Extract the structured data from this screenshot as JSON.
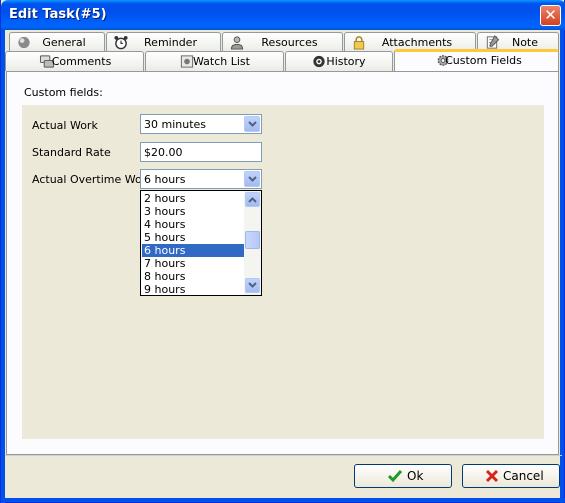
{
  "window": {
    "title": "Edit Task(#5)",
    "close_glyph": "✕"
  },
  "tabs_row1": [
    {
      "label": "General",
      "icon": "sphere-icon"
    },
    {
      "label": "Reminder",
      "icon": "alarm-clock-icon"
    },
    {
      "label": "Resources",
      "icon": "user-icon"
    },
    {
      "label": "Attachments",
      "icon": "lock-icon"
    },
    {
      "label": "Note",
      "icon": "note-icon"
    }
  ],
  "tabs_row2": [
    {
      "label": "Comments",
      "icon": "comments-icon"
    },
    {
      "label": "Watch List",
      "icon": "watch-list-icon"
    },
    {
      "label": "History",
      "icon": "history-icon"
    },
    {
      "label": "Custom Fields",
      "icon": "gear-icon",
      "active": true
    }
  ],
  "custom_fields": {
    "section_label": "Custom fields:",
    "actual_work": {
      "label": "Actual Work",
      "value": "30 minutes"
    },
    "standard_rate": {
      "label": "Standard Rate",
      "value": "$20.00"
    },
    "actual_overtime_work": {
      "label": "Actual Overtime Work",
      "value": "6 hours",
      "options": [
        "2 hours",
        "3 hours",
        "4 hours",
        "5 hours",
        "6 hours",
        "7 hours",
        "8 hours",
        "9 hours"
      ],
      "selected": "6 hours"
    }
  },
  "buttons": {
    "ok": "Ok",
    "cancel": "Cancel"
  },
  "colors": {
    "titlebar": "#0054e3",
    "tab_highlight": "#ffc73c",
    "selection": "#316ac5",
    "panel": "#ece9d8"
  }
}
